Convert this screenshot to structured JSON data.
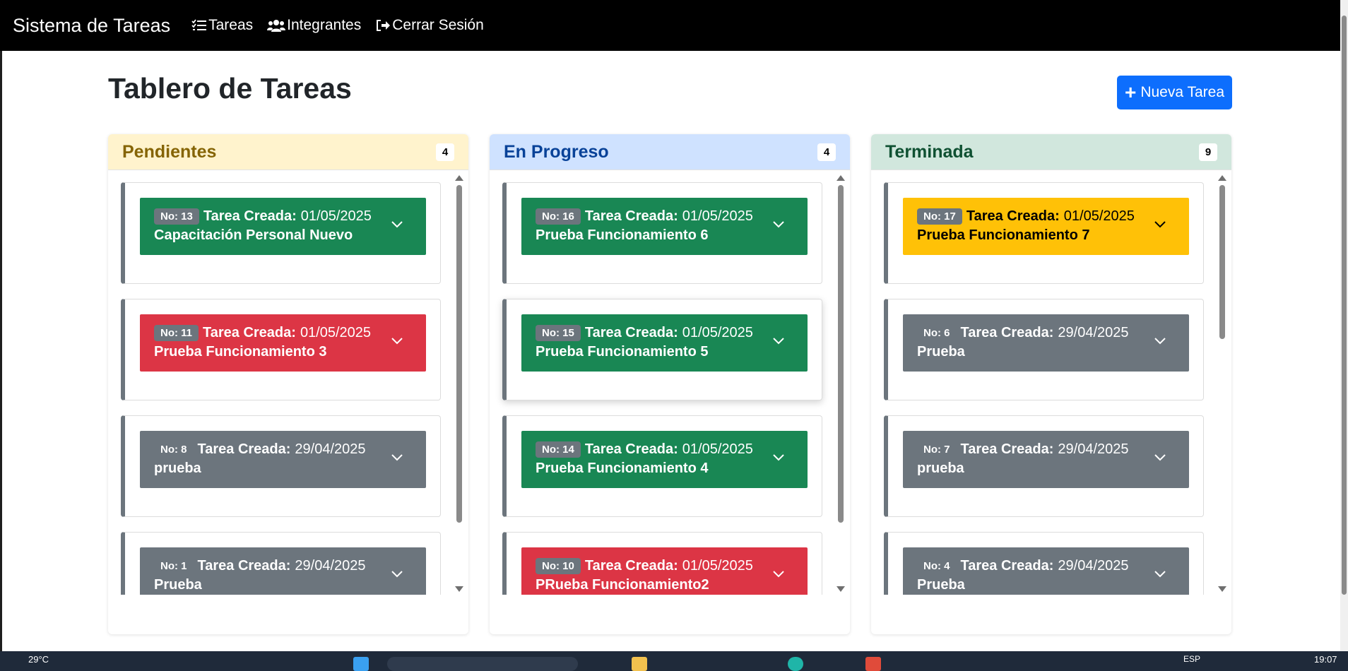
{
  "navbar": {
    "brand": "Sistema de Tareas",
    "links": [
      {
        "label": "Tareas",
        "icon": "task-list-icon"
      },
      {
        "label": "Integrantes",
        "icon": "people-icon"
      },
      {
        "label": "Cerrar Sesión",
        "icon": "logout-icon"
      }
    ]
  },
  "page": {
    "title": "Tablero de Tareas",
    "new_task_label": "Nueva Tarea"
  },
  "task_label": "Tarea Creada:",
  "columns": [
    {
      "title": "Pendientes",
      "count": "4",
      "header_bg": "#fff3cd",
      "title_color": "#856404",
      "cards": [
        {
          "no": "No: 13",
          "date": "01/05/2025",
          "name": "Capacitación Personal Nuevo",
          "color": "green"
        },
        {
          "no": "No: 11",
          "date": "01/05/2025",
          "name": "Prueba Funcionamiento 3",
          "color": "red"
        },
        {
          "no": "No: 8",
          "date": "29/04/2025",
          "name": "prueba",
          "color": "gray"
        },
        {
          "no": "No: 1",
          "date": "29/04/2025",
          "name": "Prueba",
          "color": "gray"
        }
      ]
    },
    {
      "title": "En Progreso",
      "count": "4",
      "header_bg": "#cfe2ff",
      "title_color": "#084298",
      "cards": [
        {
          "no": "No: 16",
          "date": "01/05/2025",
          "name": "Prueba Funcionamiento 6",
          "color": "green"
        },
        {
          "no": "No: 15",
          "date": "01/05/2025",
          "name": "Prueba Funcionamiento 5",
          "color": "green"
        },
        {
          "no": "No: 14",
          "date": "01/05/2025",
          "name": "Prueba Funcionamiento 4",
          "color": "green"
        },
        {
          "no": "No: 10",
          "date": "01/05/2025",
          "name": "PRueba Funcionamiento2",
          "color": "red"
        }
      ]
    },
    {
      "title": "Terminada",
      "count": "9",
      "header_bg": "#d1e7dd",
      "title_color": "#0f5132",
      "cards": [
        {
          "no": "No: 17",
          "date": "01/05/2025",
          "name": "Prueba Funcionamiento 7",
          "color": "yellow"
        },
        {
          "no": "No: 6",
          "date": "29/04/2025",
          "name": "Prueba",
          "color": "gray"
        },
        {
          "no": "No: 7",
          "date": "29/04/2025",
          "name": "prueba",
          "color": "gray"
        },
        {
          "no": "No: 4",
          "date": "29/04/2025",
          "name": "Prueba",
          "color": "gray"
        }
      ]
    }
  ],
  "taskbar": {
    "weather": "29°C",
    "lang": "ESP",
    "time": "19:07"
  },
  "colors": {
    "navbar": "#000000",
    "primary": "#0d6efd",
    "green": "#198754",
    "red": "#dc3545",
    "gray": "#6c757d",
    "yellow": "#ffc107"
  }
}
